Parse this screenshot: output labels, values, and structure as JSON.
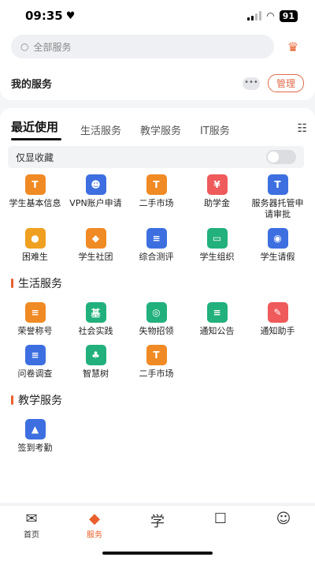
{
  "status": {
    "time": "09:35",
    "battery": "91"
  },
  "search": {
    "placeholder": "全部服务"
  },
  "my_services": {
    "title": "我的服务",
    "dots": "•••",
    "manage": "管理"
  },
  "tabs": [
    "最近使用",
    "生活服务",
    "教学服务",
    "IT服务"
  ],
  "favorites": {
    "label": "仅显收藏"
  },
  "recent": [
    {
      "label": "学生基本信息",
      "color": "#f08a24",
      "glyph": "T"
    },
    {
      "label": "VPN账户申请",
      "color": "#3d6fe0",
      "glyph": "☻"
    },
    {
      "label": "二手市场",
      "color": "#f08a24",
      "glyph": "T"
    },
    {
      "label": "助学金",
      "color": "#ef5a5a",
      "glyph": "¥"
    },
    {
      "label": "服务器托管申请审批",
      "color": "#3d6fe0",
      "glyph": "T"
    },
    {
      "label": "困难生",
      "color": "#f0a020",
      "glyph": "●"
    },
    {
      "label": "学生社团",
      "color": "#f08a24",
      "glyph": "◆"
    },
    {
      "label": "综合测评",
      "color": "#3d6fe0",
      "glyph": "≡"
    },
    {
      "label": "学生组织",
      "color": "#22b07d",
      "glyph": "▭"
    },
    {
      "label": "学生请假",
      "color": "#3d6fe0",
      "glyph": "◉"
    }
  ],
  "life_section": {
    "title": "生活服务"
  },
  "life": [
    {
      "label": "荣誉称号",
      "color": "#f08a24",
      "glyph": "≡"
    },
    {
      "label": "社会实践",
      "color": "#22b07d",
      "glyph": "基"
    },
    {
      "label": "失物招领",
      "color": "#22b07d",
      "glyph": "◎"
    },
    {
      "label": "通知公告",
      "color": "#22b07d",
      "glyph": "≡"
    },
    {
      "label": "通知助手",
      "color": "#ef5a5a",
      "glyph": "✎"
    },
    {
      "label": "问卷调查",
      "color": "#3d6fe0",
      "glyph": "≡"
    },
    {
      "label": "智慧树",
      "color": "#22b07d",
      "glyph": "♣"
    },
    {
      "label": "二手市场",
      "color": "#f08a24",
      "glyph": "T"
    }
  ],
  "teach_section": {
    "title": "教学服务"
  },
  "teach": [
    {
      "label": "签到考勤",
      "color": "#3d6fe0",
      "glyph": "▲"
    }
  ],
  "tabbar": [
    {
      "label": "首页",
      "glyph": "✉"
    },
    {
      "label": "服务",
      "glyph": "◆"
    },
    {
      "label": "",
      "glyph": "学"
    },
    {
      "label": "",
      "glyph": "☐"
    },
    {
      "label": "",
      "glyph": "☺"
    }
  ],
  "accent": "#e9602c"
}
